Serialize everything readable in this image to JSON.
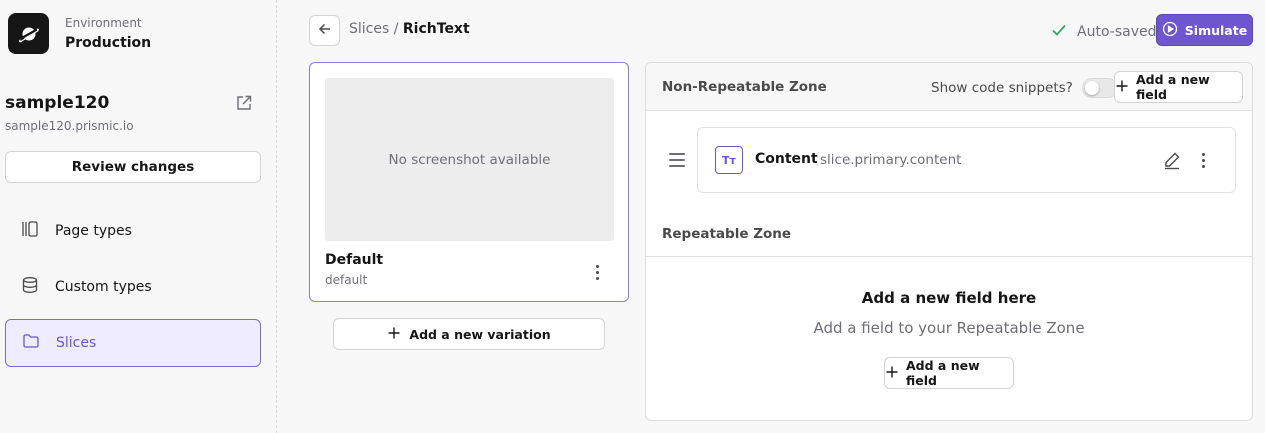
{
  "environment": {
    "label": "Environment",
    "value": "Production"
  },
  "repository": {
    "name": "sample120",
    "url": "sample120.prismic.io"
  },
  "sidebar": {
    "review_label": "Review changes",
    "items": [
      {
        "label": "Page types",
        "icon": "page-types-icon",
        "active": false
      },
      {
        "label": "Custom types",
        "icon": "database-icon",
        "active": false
      },
      {
        "label": "Slices",
        "icon": "folder-icon",
        "active": true
      }
    ]
  },
  "header": {
    "breadcrumb_parent": "Slices",
    "breadcrumb_separator": " / ",
    "breadcrumb_current": "RichText",
    "autosave_label": "Auto-saved",
    "simulate_label": "Simulate"
  },
  "variation": {
    "screenshot_placeholder": "No screenshot available",
    "name": "Default",
    "id": "default",
    "add_variation_label": "Add a new variation"
  },
  "non_repeatable": {
    "title": "Non-Repeatable Zone",
    "snippets_label": "Show code snippets?",
    "snippets_enabled": false,
    "add_field_label": "Add a new field",
    "fields": [
      {
        "label": "Content",
        "api_id": "slice.primary.content",
        "type_icon": "Tт"
      }
    ]
  },
  "repeatable": {
    "title": "Repeatable Zone",
    "empty_title": "Add a new field here",
    "empty_subtitle": "Add a field to your Repeatable Zone",
    "add_field_label": "Add a new field"
  },
  "colors": {
    "accent": "#6e56cf",
    "success": "#30a46c",
    "text": "#161616",
    "muted": "#6f6e77"
  }
}
